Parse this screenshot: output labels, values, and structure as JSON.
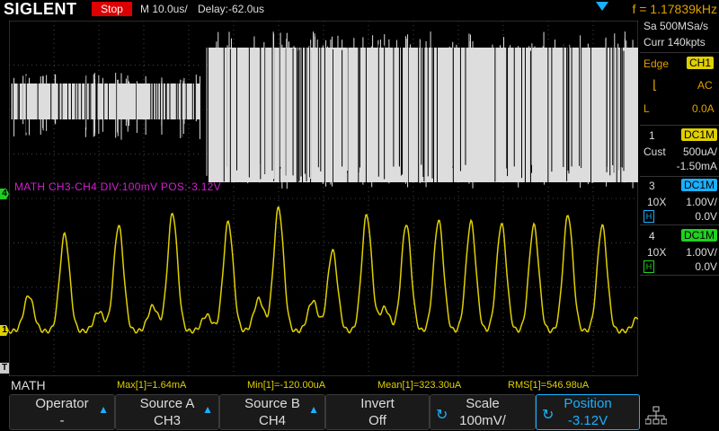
{
  "topbar": {
    "logo": "SIGLENT",
    "run_state": "Stop",
    "timebase": "M 10.0us/",
    "delay": "Delay:-62.0us",
    "frequency": "f = 1.17839kHz"
  },
  "acquisition": {
    "sample_rate": "Sa 500MSa/s",
    "memory": "Curr 140kpts"
  },
  "trigger": {
    "type": "Edge",
    "source": "CH1",
    "slope_icon": "rising-edge-icon",
    "coupling": "AC",
    "level_label": "L",
    "level": "0.0A"
  },
  "channels": [
    {
      "num": "1",
      "coupling": "DC1M",
      "probe": "Cust",
      "scale": "500uA/",
      "offset": "-1.50mA",
      "color": "#e0d000"
    },
    {
      "num": "3",
      "coupling": "DC1M",
      "probe": "10X",
      "scale": "1.00V/",
      "offset": "0.0V",
      "bw": "H",
      "color": "#1ab0ff"
    },
    {
      "num": "4",
      "coupling": "DC1M",
      "probe": "10X",
      "scale": "1.00V/",
      "offset": "0.0V",
      "bw": "H",
      "color": "#20d020"
    }
  ],
  "math_info": "MATH  CH3-CH4  DIV:100mV  POS:-3.12V",
  "markers": {
    "ch4": "4",
    "ch1": "1",
    "trigger_level": "T"
  },
  "measurements": {
    "label": "MATH",
    "max": "Max[1]=1.64mA",
    "min": "Min[1]=-120.00uA",
    "mean": "Mean[1]=323.30uA",
    "rms": "RMS[1]=546.98uA"
  },
  "softkeys": [
    {
      "label": "Operator",
      "value": "-",
      "icon": "arrow-up-icon"
    },
    {
      "label": "Source A",
      "value": "CH3",
      "icon": "arrow-up-icon"
    },
    {
      "label": "Source B",
      "value": "CH4",
      "icon": "arrow-up-icon"
    },
    {
      "label": "Invert",
      "value": "Off",
      "icon": ""
    },
    {
      "label": "Scale",
      "value": "100mV/",
      "icon": "knob-icon"
    },
    {
      "label": "Position",
      "value": "-3.12V",
      "icon": "knob-icon"
    }
  ],
  "colors": {
    "math": "#d020d0",
    "ch1": "#e0d000",
    "accent": "#1ab0ff",
    "stop": "#dd0000"
  }
}
